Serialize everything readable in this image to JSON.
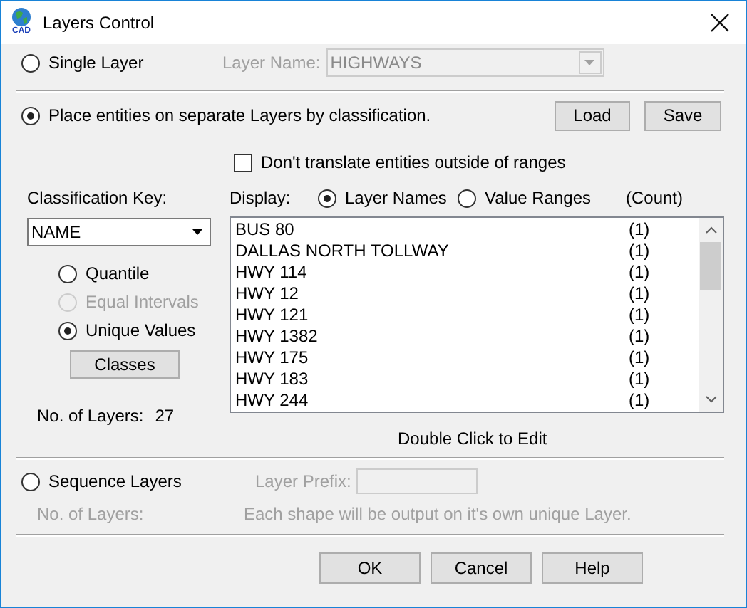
{
  "window": {
    "title": "Layers Control",
    "icon_text": "CAD"
  },
  "single_layer": {
    "label": "Single Layer",
    "selected": false,
    "disabled": true,
    "layer_name_label": "Layer Name:",
    "layer_name": "HIGHWAYS"
  },
  "classification": {
    "label": "Place entities on separate Layers by classification.",
    "selected": true
  },
  "top_buttons": [
    "Load",
    "Save"
  ],
  "dont_translate": {
    "label": "Don't translate entities outside of ranges",
    "checked": false
  },
  "classification_key": {
    "label": "Classification Key:",
    "value": "NAME"
  },
  "methods": [
    {
      "label": "Quantile",
      "selected": false,
      "disabled": false
    },
    {
      "label": "Equal Intervals",
      "selected": false,
      "disabled": true
    },
    {
      "label": "Unique Values",
      "selected": true,
      "disabled": false
    }
  ],
  "classes_button": "Classes",
  "layer_count": {
    "label": "No. of Layers:",
    "value": "27"
  },
  "display": {
    "label": "Display:",
    "count_header": "(Count)",
    "options": [
      {
        "label": "Layer Names",
        "selected": true
      },
      {
        "label": "Value Ranges",
        "selected": false
      }
    ]
  },
  "layers": [
    {
      "name": "BUS 80",
      "count": "(1)"
    },
    {
      "name": "DALLAS NORTH TOLLWAY",
      "count": "(1)"
    },
    {
      "name": "HWY 114",
      "count": "(1)"
    },
    {
      "name": "HWY 12",
      "count": "(1)"
    },
    {
      "name": "HWY 121",
      "count": "(1)"
    },
    {
      "name": "HWY 1382",
      "count": "(1)"
    },
    {
      "name": "HWY 175",
      "count": "(1)"
    },
    {
      "name": "HWY 183",
      "count": "(1)"
    },
    {
      "name": "HWY 244",
      "count": "(1)"
    }
  ],
  "hint": "Double Click to Edit",
  "sequence": {
    "label": "Sequence Layers",
    "selected": false,
    "disabled": true,
    "prefix_label": "Layer Prefix:",
    "count_label": "No. of Layers:",
    "note": "Each shape will be output on it's own unique Layer."
  },
  "buttons": [
    "OK",
    "Cancel",
    "Help"
  ]
}
